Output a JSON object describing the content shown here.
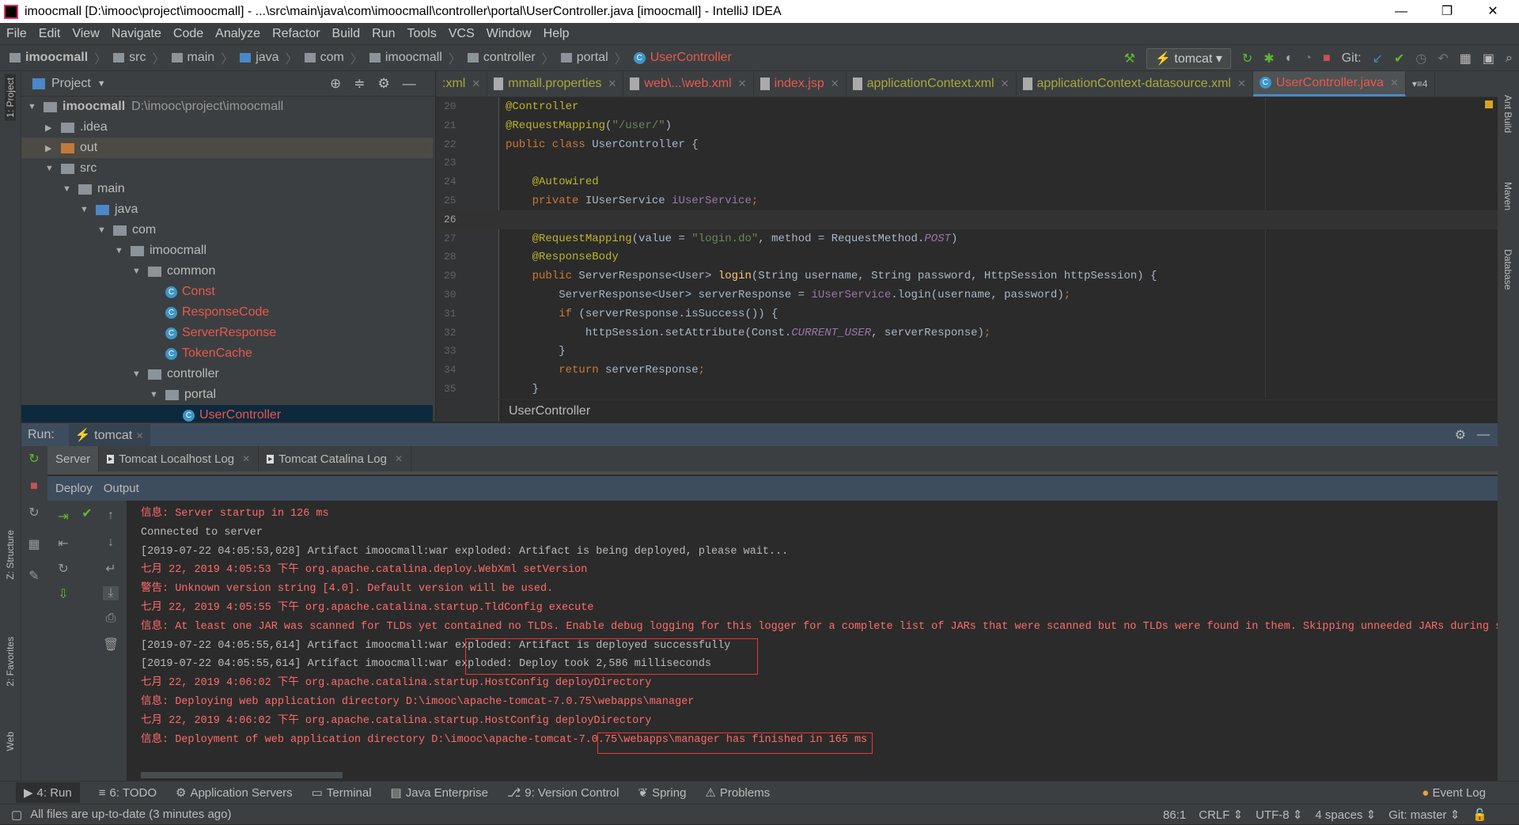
{
  "window": {
    "title": "imoocmall [D:\\imooc\\project\\imoocmall] - ...\\src\\main\\java\\com\\imoocmall\\controller\\portal\\UserController.java [imoocmall] - IntelliJ IDEA"
  },
  "menu": [
    "File",
    "Edit",
    "View",
    "Navigate",
    "Code",
    "Analyze",
    "Refactor",
    "Build",
    "Run",
    "Tools",
    "VCS",
    "Window",
    "Help"
  ],
  "breadcrumb": [
    "imoocmall",
    "src",
    "main",
    "java",
    "com",
    "imoocmall",
    "controller",
    "portal",
    "UserController"
  ],
  "toolbar": {
    "run_config": "tomcat",
    "git_label": "Git:"
  },
  "left_strip": [
    "1: Project",
    "Z: Structure",
    "2: Favorites",
    "Web"
  ],
  "right_strip": [
    "Ant Build",
    "Maven",
    "Database"
  ],
  "project": {
    "title": "Project",
    "tree": [
      {
        "label": "imoocmall",
        "extra": "D:\\imooc\\project\\imoocmall",
        "depth": 0,
        "arrow": "▼",
        "bold": true
      },
      {
        "label": ".idea",
        "depth": 1,
        "arrow": "▶"
      },
      {
        "label": "out",
        "depth": 1,
        "arrow": "▶",
        "selected": true,
        "color": "#c07a3a"
      },
      {
        "label": "src",
        "depth": 1,
        "arrow": "▼"
      },
      {
        "label": "main",
        "depth": 2,
        "arrow": "▼"
      },
      {
        "label": "java",
        "depth": 3,
        "arrow": "▼",
        "color": "#4a88c7"
      },
      {
        "label": "com",
        "depth": 4,
        "arrow": "▼"
      },
      {
        "label": "imoocmall",
        "depth": 5,
        "arrow": "▼"
      },
      {
        "label": "common",
        "depth": 6,
        "arrow": "▼"
      },
      {
        "label": "Const",
        "depth": 7,
        "cls": true
      },
      {
        "label": "ResponseCode",
        "depth": 7,
        "cls": true
      },
      {
        "label": "ServerResponse",
        "depth": 7,
        "cls": true
      },
      {
        "label": "TokenCache",
        "depth": 7,
        "cls": true
      },
      {
        "label": "controller",
        "depth": 6,
        "arrow": "▼"
      },
      {
        "label": "portal",
        "depth": 7,
        "arrow": "▼"
      },
      {
        "label": "UserController",
        "depth": 8,
        "cls": true
      }
    ]
  },
  "editor_tabs": [
    {
      "label": ":xml",
      "color": "#a8a83a"
    },
    {
      "label": "mmall.properties",
      "color": "#a8a83a"
    },
    {
      "label": "web\\...\\web.xml",
      "color": "#e8584e"
    },
    {
      "label": "index.jsp",
      "color": "#e8584e"
    },
    {
      "label": "applicationContext.xml",
      "color": "#a8a83a"
    },
    {
      "label": "applicationContext-datasource.xml",
      "color": "#a8a83a"
    },
    {
      "label": "UserController.java",
      "color": "#e8584e",
      "active": true
    }
  ],
  "code": {
    "first_line": 20,
    "current_line": 26,
    "lines": [
      [
        [
          "@Controller",
          "an"
        ]
      ],
      [
        [
          "@RequestMapping",
          "an"
        ],
        [
          "(",
          "pl"
        ],
        [
          "\"/user/\"",
          "st"
        ],
        [
          ")",
          "pl"
        ]
      ],
      [
        [
          "public class ",
          "kw"
        ],
        [
          "UserController {",
          "pl"
        ]
      ],
      [],
      [
        [
          "    @Autowired",
          "an"
        ]
      ],
      [
        [
          "    private ",
          "kw"
        ],
        [
          "IUserService ",
          "pl"
        ],
        [
          "iUserService",
          "fd"
        ],
        [
          ";",
          "kw"
        ]
      ],
      [],
      [
        [
          "    @RequestMapping",
          "an"
        ],
        [
          "(value = ",
          "pl"
        ],
        [
          "\"login.do\"",
          "st"
        ],
        [
          ", method = RequestMethod.",
          "pl"
        ],
        [
          "POST",
          "it"
        ],
        [
          ")",
          "pl"
        ]
      ],
      [
        [
          "    @ResponseBody",
          "an"
        ]
      ],
      [
        [
          "    public ",
          "kw"
        ],
        [
          "ServerResponse<User> ",
          "pl"
        ],
        [
          "login",
          "fn"
        ],
        [
          "(String username, String password, HttpSession httpSession) {",
          "pl"
        ]
      ],
      [
        [
          "        ServerResponse<User> serverResponse = ",
          "pl"
        ],
        [
          "iUserService",
          "fd"
        ],
        [
          ".login(username, password)",
          "pl"
        ],
        [
          ";",
          "kw"
        ]
      ],
      [
        [
          "        if ",
          "kw"
        ],
        [
          "(serverResponse.isSuccess()) {",
          "pl"
        ]
      ],
      [
        [
          "            httpSession.setAttribute(Const.",
          "pl"
        ],
        [
          "CURRENT_USER",
          "it"
        ],
        [
          ", serverResponse)",
          "pl"
        ],
        [
          ";",
          "kw"
        ]
      ],
      [
        [
          "        }",
          "pl"
        ]
      ],
      [
        [
          "        return ",
          "kw"
        ],
        [
          "serverResponse",
          "pl"
        ],
        [
          ";",
          "kw"
        ]
      ],
      [
        [
          "    }",
          "pl"
        ]
      ]
    ]
  },
  "editor_breadcrumb": "UserController",
  "run": {
    "label": "Run:",
    "config": "tomcat",
    "tabs": [
      "Server",
      "Tomcat Localhost Log",
      "Tomcat Catalina Log"
    ],
    "sub_tabs": [
      "Deploy",
      "Output"
    ]
  },
  "console": [
    {
      "text": "信息: Server startup in 126 ms",
      "type": "err"
    },
    {
      "text": "Connected to server",
      "type": "info"
    },
    {
      "text": "[2019-07-22 04:05:53,028] Artifact imoocmall:war exploded: Artifact is being deployed, please wait...",
      "type": "info"
    },
    {
      "text": "七月 22, 2019 4:05:53 下午 org.apache.catalina.deploy.WebXml setVersion",
      "type": "err"
    },
    {
      "text": "警告: Unknown version string [4.0]. Default version will be used.",
      "type": "err"
    },
    {
      "text": "七月 22, 2019 4:05:55 下午 org.apache.catalina.startup.TldConfig execute",
      "type": "err"
    },
    {
      "text": "信息: At least one JAR was scanned for TLDs yet contained no TLDs. Enable debug logging for this logger for a complete list of JARs that were scanned but no TLDs were found in them. Skipping unneeded JARs during sca",
      "type": "err"
    },
    {
      "text": "[2019-07-22 04:05:55,614] Artifact imoocmall:war exploded: Artifact is deployed successfully",
      "type": "info"
    },
    {
      "text": "[2019-07-22 04:05:55,614] Artifact imoocmall:war exploded: Deploy took 2,586 milliseconds",
      "type": "info"
    },
    {
      "text": "七月 22, 2019 4:06:02 下午 org.apache.catalina.startup.HostConfig deployDirectory",
      "type": "err"
    },
    {
      "text": "信息: Deploying web application directory D:\\imooc\\apache-tomcat-7.0.75\\webapps\\manager",
      "type": "err"
    },
    {
      "text": "七月 22, 2019 4:06:02 下午 org.apache.catalina.startup.HostConfig deployDirectory",
      "type": "err"
    },
    {
      "text": "信息: Deployment of web application directory D:\\imooc\\apache-tomcat-7.0.75\\webapps\\manager has finished in 165 ms",
      "type": "err"
    }
  ],
  "bottom_tools": [
    "4: Run",
    "6: TODO",
    "Application Servers",
    "Terminal",
    "Java Enterprise",
    "9: Version Control",
    "Spring",
    "Problems"
  ],
  "event_log": "Event Log",
  "status": {
    "message": "All files are up-to-date (3 minutes ago)",
    "position": "86:1",
    "line_sep": "CRLF",
    "encoding": "UTF-8",
    "indent": "4 spaces",
    "git": "Git: master"
  }
}
